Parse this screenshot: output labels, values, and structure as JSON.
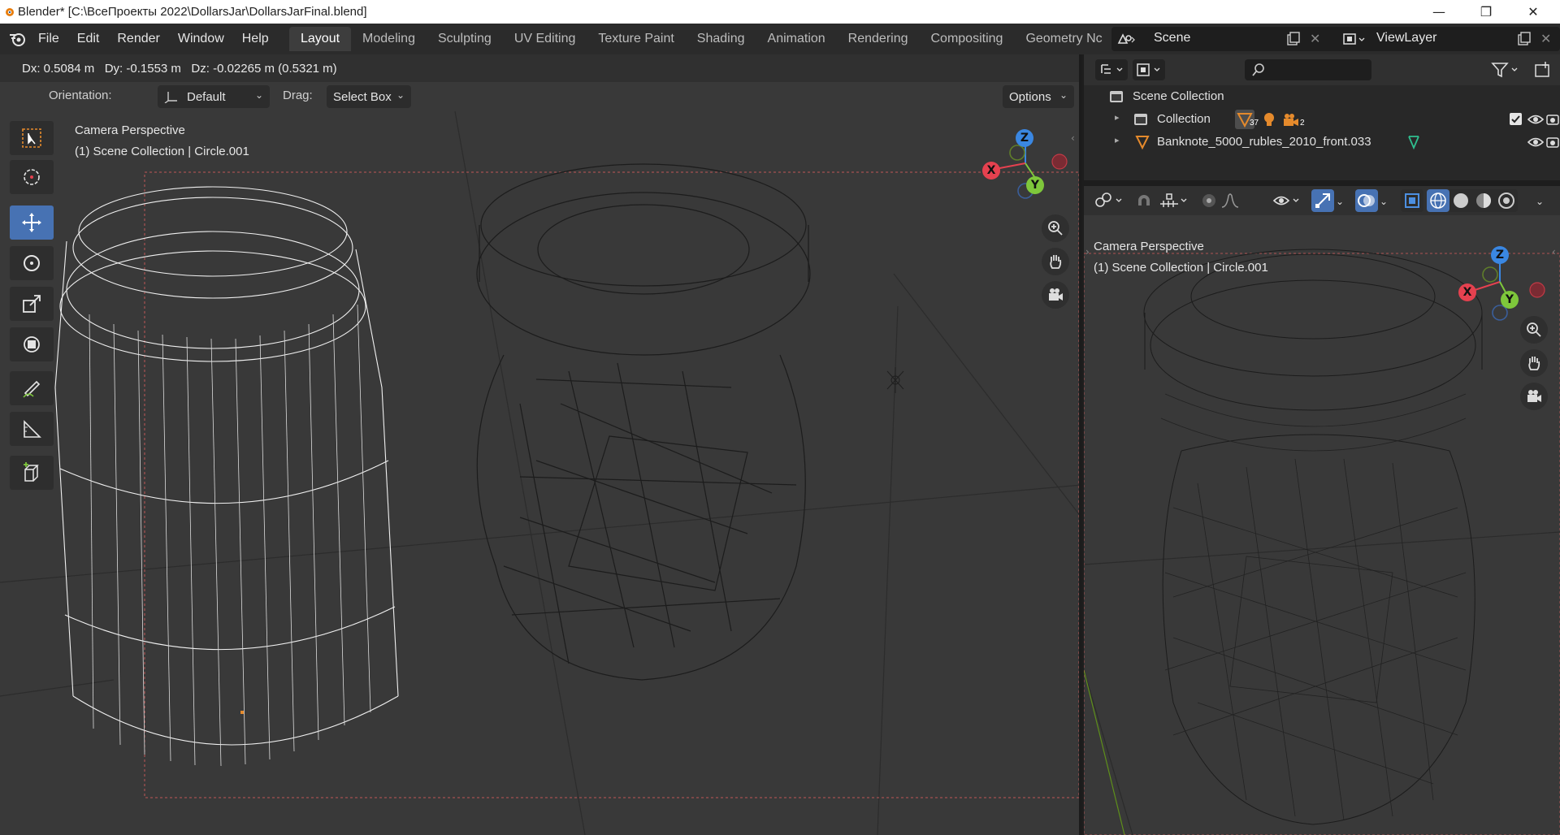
{
  "window": {
    "title": "Blender* [C:\\ВсеПроекты 2022\\DollarsJar\\DollarsJarFinal.blend]",
    "minimize": "—",
    "restore": "❐",
    "close": "✕"
  },
  "menu": [
    "File",
    "Edit",
    "Render",
    "Window",
    "Help"
  ],
  "workspaces": [
    "Layout",
    "Modeling",
    "Sculpting",
    "UV Editing",
    "Texture Paint",
    "Shading",
    "Animation",
    "Rendering",
    "Compositing",
    "Geometry Nc"
  ],
  "active_workspace": "Layout",
  "scene": {
    "name": "Scene",
    "view_layer": "ViewLayer"
  },
  "transform_status": "Dx: 0.5084 m   Dy: -0.1553 m   Dz: -0.02265 m (0.5321 m)",
  "tool_header": {
    "orientation_label": "Orientation:",
    "orientation_value": "Default",
    "drag_label": "Drag:",
    "drag_value": "Select Box",
    "options_label": "Options"
  },
  "viewport_main": {
    "view_name": "Camera Perspective",
    "collection_info": "(1) Scene Collection | Circle.001",
    "gizmo": {
      "x": "X",
      "y": "Y",
      "z": "Z"
    }
  },
  "viewport_side": {
    "view_name": "Camera Perspective",
    "collection_info": "(1) Scene Collection | Circle.001",
    "gizmo": {
      "x": "X",
      "y": "Y",
      "z": "Z"
    }
  },
  "outliner": {
    "root": "Scene Collection",
    "items": [
      {
        "name": "Collection",
        "badge1": "37",
        "badge2": "2"
      },
      {
        "name": "Banknote_5000_rubles_2010_front.033"
      }
    ]
  },
  "colors": {
    "accent": "#4772b3",
    "axis_x": "#e5414f",
    "axis_y": "#7ec73b",
    "axis_z": "#3a87e2",
    "object_orange": "#e58a2c"
  }
}
